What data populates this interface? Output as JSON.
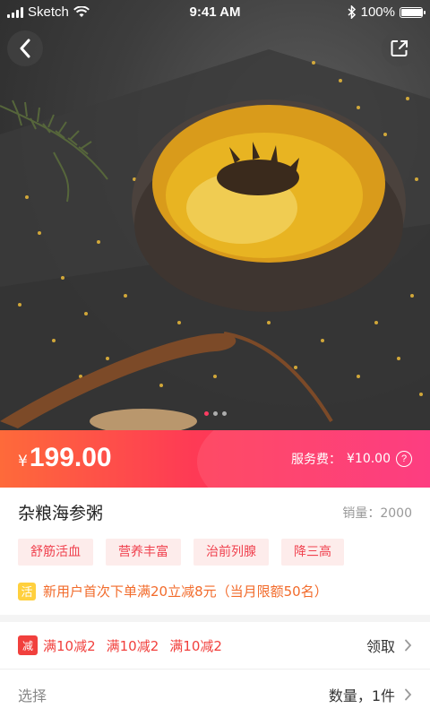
{
  "status_bar": {
    "carrier": "Sketch",
    "time": "9:41 AM",
    "battery": "100%"
  },
  "gallery": {
    "page_count": 3,
    "active_index": 0
  },
  "product": {
    "currency": "¥",
    "price": "199.00",
    "service_fee_label": "服务费：",
    "service_fee": "¥10.00",
    "name": "杂粮海参粥",
    "sales_label": "销量：",
    "sales": "2000",
    "tags": [
      "舒筋活血",
      "营养丰富",
      "治前列腺",
      "降三高"
    ]
  },
  "promo": {
    "badge": "活",
    "text": "新用户首次下单满20立减8元（当月限额50名）"
  },
  "coupons": {
    "badge": "减",
    "items": [
      "满10减2",
      "满10减2",
      "满10减2"
    ],
    "action": "领取"
  },
  "select": {
    "label": "选择",
    "value": "数量，1件"
  },
  "colors": {
    "accent": "#fe3a55",
    "tag_text": "#f0424f",
    "promo_text": "#f26b2b",
    "badge_yellow": "#ffd03e"
  }
}
